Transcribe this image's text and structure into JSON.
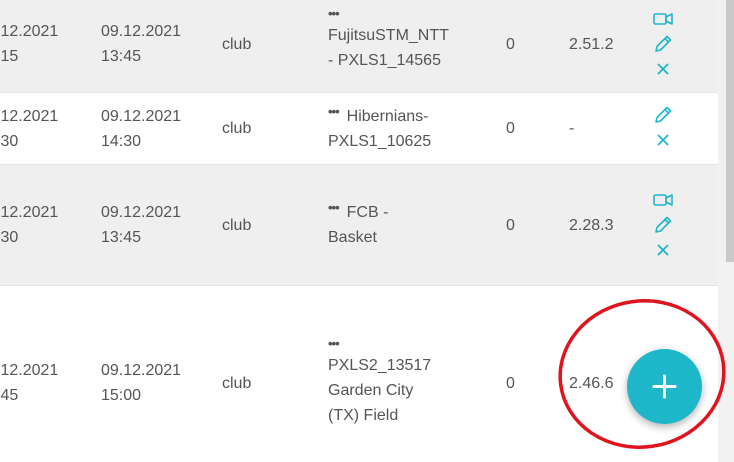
{
  "rows": [
    {
      "start_date": ".12.2021",
      "start_time": ":15",
      "end_date": "09.12.2021",
      "end_time": "13:45",
      "type": "club",
      "name_line1": "FujitsuSTM_NTT",
      "name_line2": "- PXLS1_14565",
      "count": "0",
      "version": "2.51.2"
    },
    {
      "start_date": ".12.2021",
      "start_time": ":30",
      "end_date": "09.12.2021",
      "end_time": "14:30",
      "type": "club",
      "name_line1": "Hibernians-",
      "name_line2": "PXLS1_10625",
      "count": "0",
      "version": "-"
    },
    {
      "start_date": ".12.2021",
      "start_time": ":30",
      "end_date": "09.12.2021",
      "end_time": "13:45",
      "type": "club",
      "name_line1": "FCB -",
      "name_line2": "Basket",
      "count": "0",
      "version": "2.28.3"
    },
    {
      "start_date": ".12.2021",
      "start_time": ":45",
      "end_date": "09.12.2021",
      "end_time": "15:00",
      "type": "club",
      "name_line1": "PXLS2_13517",
      "name_line2": "Garden City",
      "name_line3": "(TX) Field",
      "count": "0",
      "version": "2.46.6"
    }
  ],
  "more_glyph": "•••",
  "icons": {
    "video": "video-camera-icon",
    "edit": "pencil-icon",
    "delete": "close-icon",
    "add": "plus-icon"
  },
  "colors": {
    "accent": "#1eb6c9",
    "highlight": "#e0141e",
    "row_shaded": "#efefef"
  }
}
